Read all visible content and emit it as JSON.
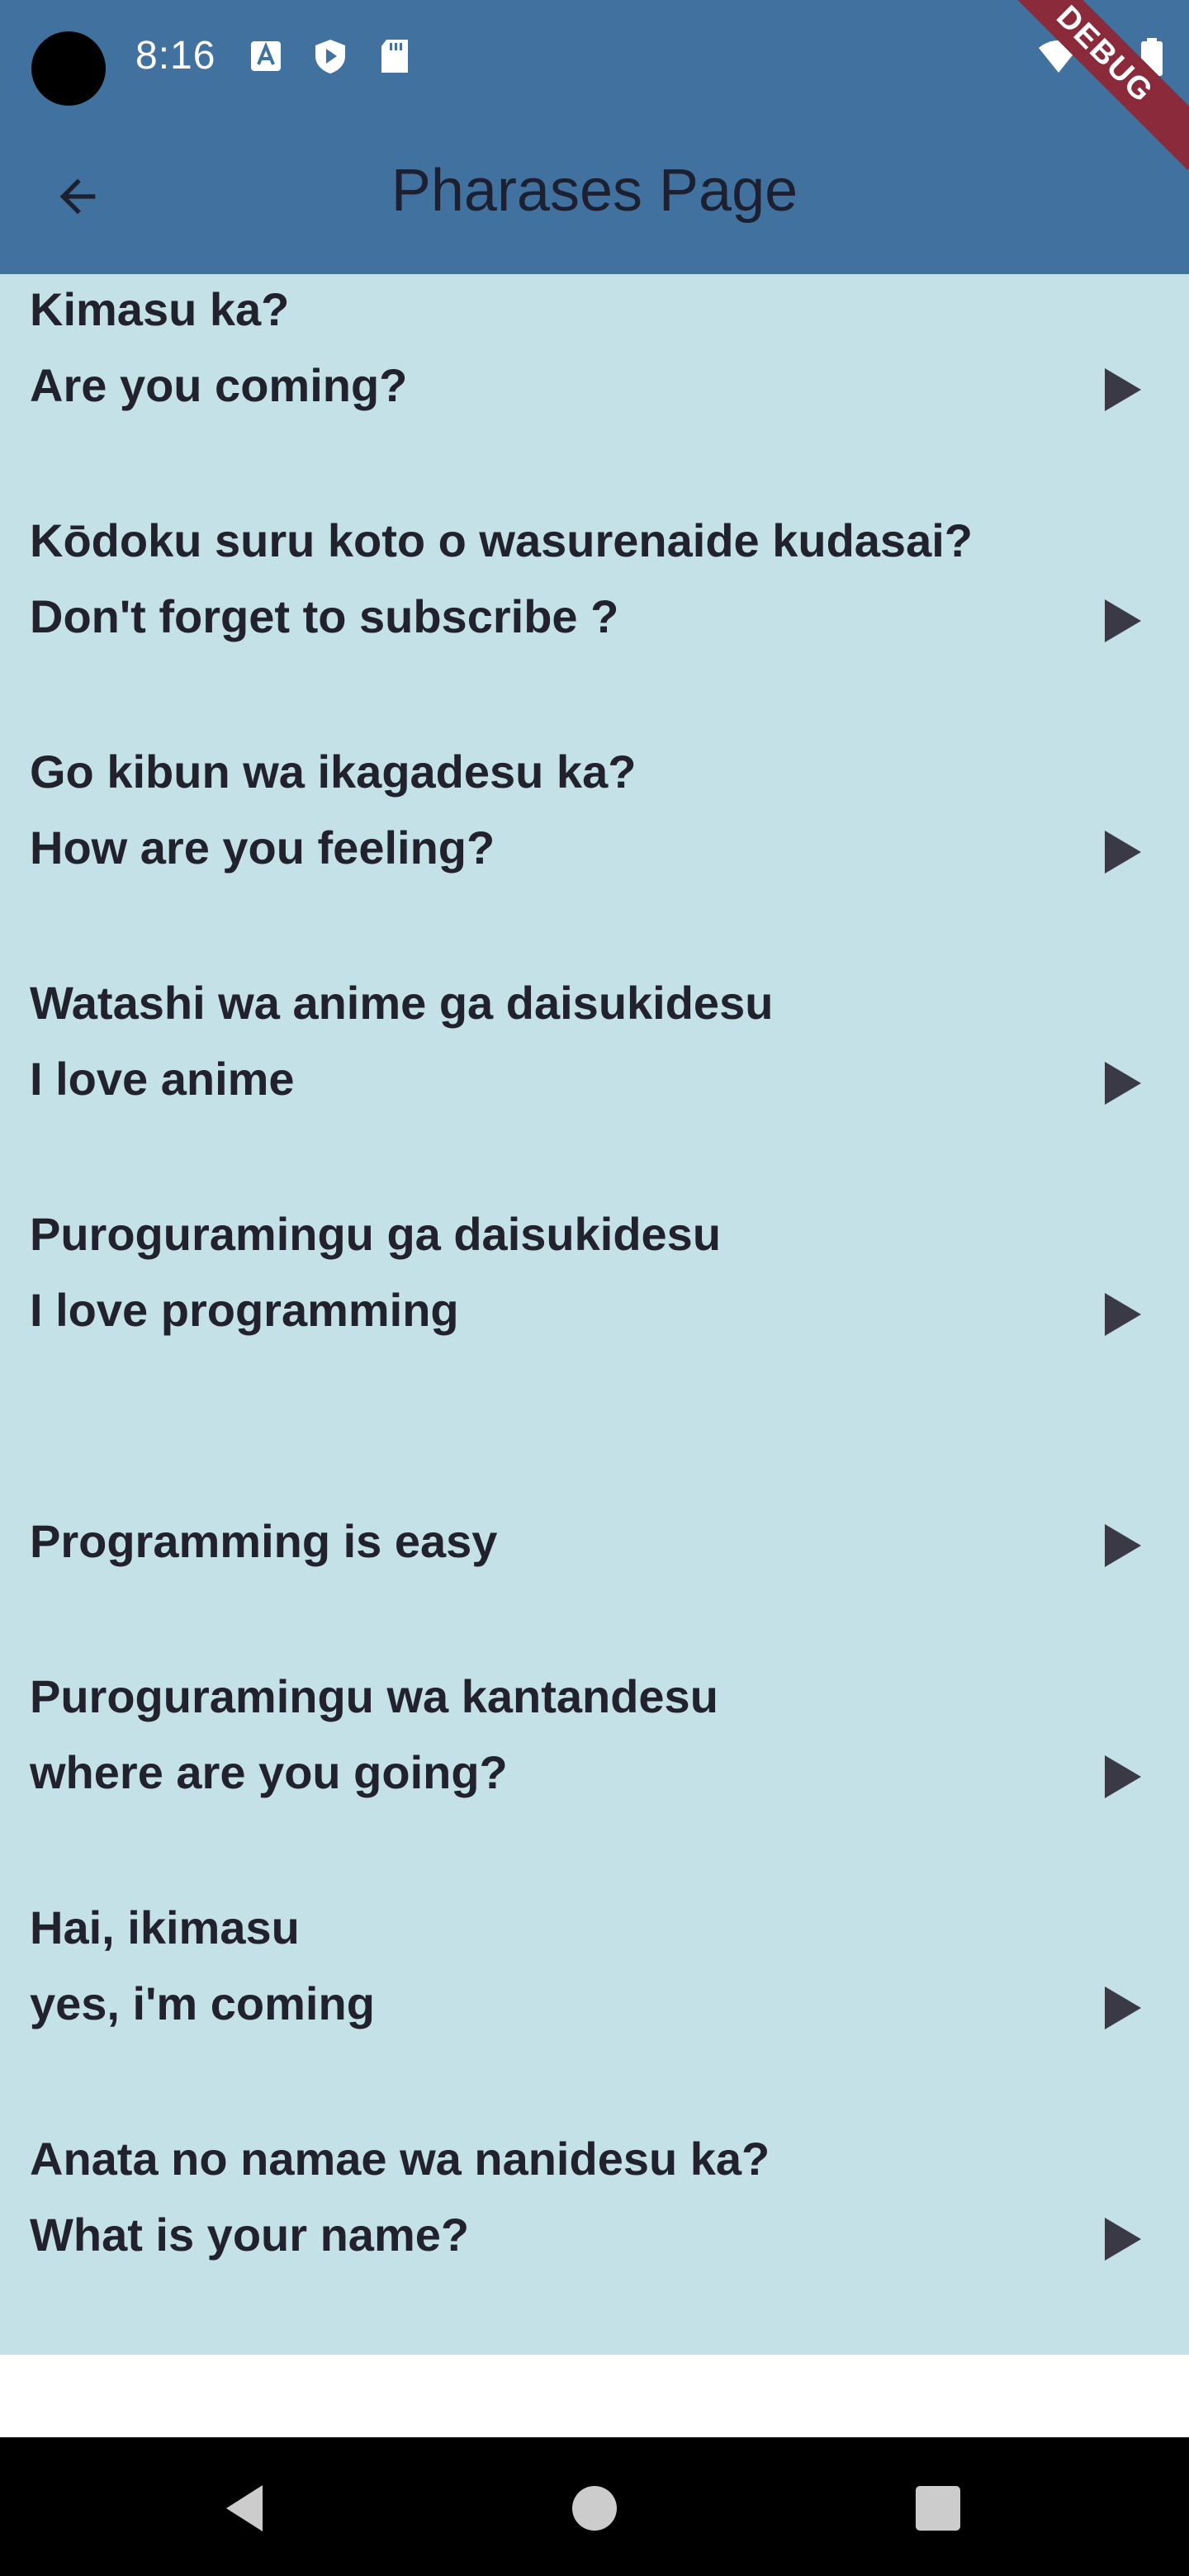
{
  "status_bar": {
    "time": "8:16",
    "icons": [
      "text-a-icon",
      "shield-play-icon",
      "sd-card-icon",
      "wifi-icon",
      "battery-icon"
    ]
  },
  "app_bar": {
    "title": "Pharases Page",
    "back_icon": "arrow-back-icon",
    "debug_label": "DEBUG",
    "color": "#41729f"
  },
  "colors": {
    "content_bg": "#c3e1e6",
    "text": "#22222e",
    "debug_ribbon": "#8b2a3a"
  },
  "phrases": [
    {
      "jp": "Kimasu ka?",
      "en": "Are you coming?"
    },
    {
      "jp": "Kōdoku suru koto o wasurenaide kudasai?",
      "en": "Don't forget to subscribe ?"
    },
    {
      "jp": "Go kibun wa ikagadesu ka?",
      "en": "How are you feeling?"
    },
    {
      "jp": "Watashi wa anime ga daisukidesu",
      "en": "I love anime"
    },
    {
      "jp": "Puroguramingu ga daisukidesu",
      "en": "I love programming"
    },
    {
      "jp": "",
      "en": "Programming is easy"
    },
    {
      "jp": "Puroguramingu wa kantandesu",
      "en": "where are you going?"
    },
    {
      "jp": "Hai, ikimasu",
      "en": "yes, i'm coming"
    },
    {
      "jp": "Anata no namae wa nanidesu ka?",
      "en": "What is your name?"
    }
  ],
  "nav_bar": {
    "buttons": [
      "nav-back-icon",
      "nav-home-icon",
      "nav-recents-icon"
    ]
  }
}
